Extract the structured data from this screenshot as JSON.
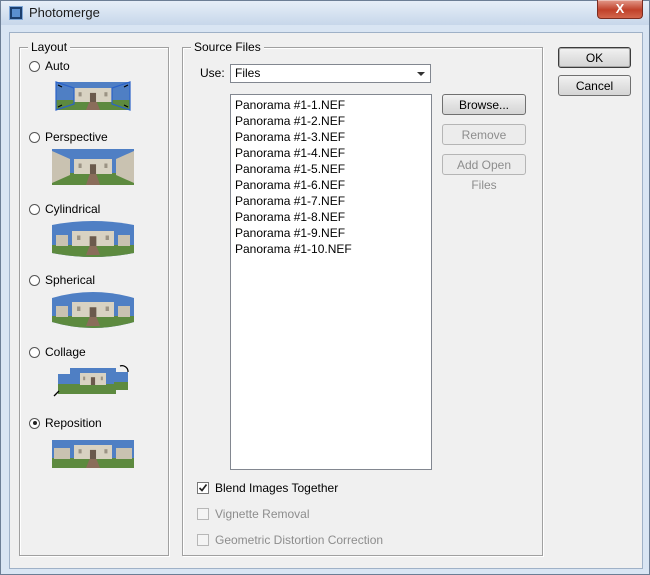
{
  "window": {
    "title": "Photomerge",
    "close_glyph": "X"
  },
  "layout": {
    "legend": "Layout",
    "options": [
      {
        "label": "Auto",
        "selected": false,
        "thumb": "auto"
      },
      {
        "label": "Perspective",
        "selected": false,
        "thumb": "perspective"
      },
      {
        "label": "Cylindrical",
        "selected": false,
        "thumb": "cylindrical"
      },
      {
        "label": "Spherical",
        "selected": false,
        "thumb": "spherical"
      },
      {
        "label": "Collage",
        "selected": false,
        "thumb": "collage"
      },
      {
        "label": "Reposition",
        "selected": true,
        "thumb": "reposition"
      }
    ]
  },
  "source": {
    "legend": "Source Files",
    "use_label": "Use:",
    "use_value": "Files",
    "files": [
      "Panorama #1-1.NEF",
      "Panorama #1-2.NEF",
      "Panorama #1-3.NEF",
      "Panorama #1-4.NEF",
      "Panorama #1-5.NEF",
      "Panorama #1-6.NEF",
      "Panorama #1-7.NEF",
      "Panorama #1-8.NEF",
      "Panorama #1-9.NEF",
      "Panorama #1-10.NEF"
    ],
    "browse": "Browse...",
    "remove": "Remove",
    "add_open": "Add Open Files",
    "blend": {
      "label": "Blend Images Together",
      "checked": true,
      "enabled": true
    },
    "vignette": {
      "label": "Vignette Removal",
      "checked": false,
      "enabled": false
    },
    "geometric": {
      "label": "Geometric Distortion Correction",
      "checked": false,
      "enabled": false
    }
  },
  "buttons": {
    "ok": "OK",
    "cancel": "Cancel"
  },
  "colors": {
    "sky": "#4f7fc4",
    "building": "#d8d2c2",
    "lawn": "#5d8a3f",
    "path": "#8a6d5a",
    "accent_frame": "#2a62c9"
  }
}
